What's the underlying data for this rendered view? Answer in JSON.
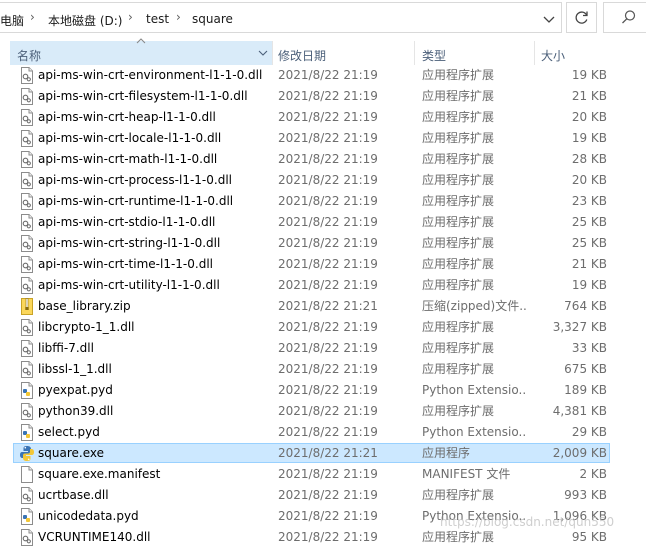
{
  "address_bar": {
    "crumbs": [
      "电脑",
      "本地磁盘 (D:)",
      "test",
      "square"
    ]
  },
  "columns": {
    "name": "名称",
    "date": "修改日期",
    "type": "类型",
    "size": "大小"
  },
  "files": [
    {
      "name": "api-ms-win-crt-environment-l1-1-0.dll",
      "date": "2021/8/22 21:19",
      "type": "应用程序扩展",
      "size": "19 KB",
      "icon": "dll-icon"
    },
    {
      "name": "api-ms-win-crt-filesystem-l1-1-0.dll",
      "date": "2021/8/22 21:19",
      "type": "应用程序扩展",
      "size": "21 KB",
      "icon": "dll-icon"
    },
    {
      "name": "api-ms-win-crt-heap-l1-1-0.dll",
      "date": "2021/8/22 21:19",
      "type": "应用程序扩展",
      "size": "20 KB",
      "icon": "dll-icon"
    },
    {
      "name": "api-ms-win-crt-locale-l1-1-0.dll",
      "date": "2021/8/22 21:19",
      "type": "应用程序扩展",
      "size": "19 KB",
      "icon": "dll-icon"
    },
    {
      "name": "api-ms-win-crt-math-l1-1-0.dll",
      "date": "2021/8/22 21:19",
      "type": "应用程序扩展",
      "size": "28 KB",
      "icon": "dll-icon"
    },
    {
      "name": "api-ms-win-crt-process-l1-1-0.dll",
      "date": "2021/8/22 21:19",
      "type": "应用程序扩展",
      "size": "20 KB",
      "icon": "dll-icon"
    },
    {
      "name": "api-ms-win-crt-runtime-l1-1-0.dll",
      "date": "2021/8/22 21:19",
      "type": "应用程序扩展",
      "size": "23 KB",
      "icon": "dll-icon"
    },
    {
      "name": "api-ms-win-crt-stdio-l1-1-0.dll",
      "date": "2021/8/22 21:19",
      "type": "应用程序扩展",
      "size": "25 KB",
      "icon": "dll-icon"
    },
    {
      "name": "api-ms-win-crt-string-l1-1-0.dll",
      "date": "2021/8/22 21:19",
      "type": "应用程序扩展",
      "size": "25 KB",
      "icon": "dll-icon"
    },
    {
      "name": "api-ms-win-crt-time-l1-1-0.dll",
      "date": "2021/8/22 21:19",
      "type": "应用程序扩展",
      "size": "21 KB",
      "icon": "dll-icon"
    },
    {
      "name": "api-ms-win-crt-utility-l1-1-0.dll",
      "date": "2021/8/22 21:19",
      "type": "应用程序扩展",
      "size": "19 KB",
      "icon": "dll-icon"
    },
    {
      "name": "base_library.zip",
      "date": "2021/8/22 21:21",
      "type": "压缩(zipped)文件...",
      "size": "764 KB",
      "icon": "zip-icon"
    },
    {
      "name": "libcrypto-1_1.dll",
      "date": "2021/8/22 21:19",
      "type": "应用程序扩展",
      "size": "3,327 KB",
      "icon": "dll-icon"
    },
    {
      "name": "libffi-7.dll",
      "date": "2021/8/22 21:19",
      "type": "应用程序扩展",
      "size": "33 KB",
      "icon": "dll-icon"
    },
    {
      "name": "libssl-1_1.dll",
      "date": "2021/8/22 21:19",
      "type": "应用程序扩展",
      "size": "675 KB",
      "icon": "dll-icon"
    },
    {
      "name": "pyexpat.pyd",
      "date": "2021/8/22 21:19",
      "type": "Python Extensio...",
      "size": "189 KB",
      "icon": "pyd-icon"
    },
    {
      "name": "python39.dll",
      "date": "2021/8/22 21:19",
      "type": "应用程序扩展",
      "size": "4,381 KB",
      "icon": "dll-icon"
    },
    {
      "name": "select.pyd",
      "date": "2021/8/22 21:19",
      "type": "Python Extensio...",
      "size": "29 KB",
      "icon": "pyd-icon"
    },
    {
      "name": "square.exe",
      "date": "2021/8/22 21:21",
      "type": "应用程序",
      "size": "2,009 KB",
      "icon": "python-exe-icon",
      "selected": true
    },
    {
      "name": "square.exe.manifest",
      "date": "2021/8/22 21:19",
      "type": "MANIFEST 文件",
      "size": "2 KB",
      "icon": "file-icon"
    },
    {
      "name": "ucrtbase.dll",
      "date": "2021/8/22 21:19",
      "type": "应用程序扩展",
      "size": "993 KB",
      "icon": "dll-icon"
    },
    {
      "name": "unicodedata.pyd",
      "date": "2021/8/22 21:19",
      "type": "Python Extensio...",
      "size": "1,096 KB",
      "icon": "pyd-icon"
    },
    {
      "name": "VCRUNTIME140.dll",
      "date": "2021/8/22 21:19",
      "type": "应用程序扩展",
      "size": "95 KB",
      "icon": "dll-icon"
    }
  ],
  "watermark": "https://blog.csdn.net/qun550",
  "colors": {
    "selection_bg": "#cce8ff",
    "selection_border": "#99d1ff",
    "header_hover_bg": "#d9ebf9",
    "header_text": "#4c607a",
    "secondary_text": "#6d6d6d"
  }
}
